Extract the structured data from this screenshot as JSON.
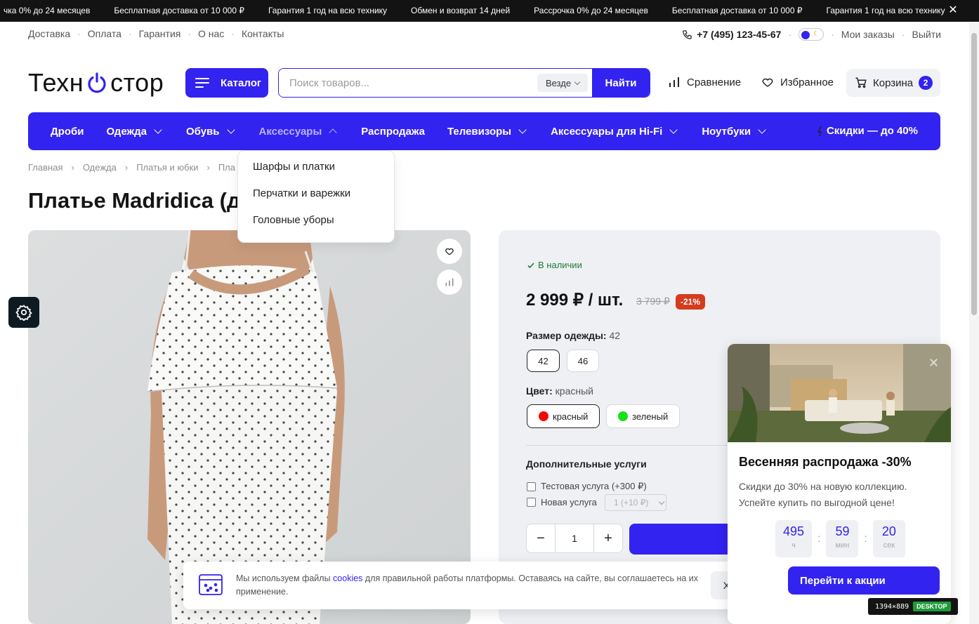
{
  "ticker": {
    "items": [
      "чка 0% до 24 месяцев",
      "Бесплатная доставка от 10 000 ₽",
      "Гарантия 1 год на всю технику",
      "Обмен и возврат 14 дней",
      "Рассрочка 0% до 24 месяцев",
      "Бесплатная доставка от 10 000 ₽",
      "Гарантия 1 год на всю технику"
    ],
    "close": "✕"
  },
  "util": {
    "links": [
      "Доставка",
      "Оплата",
      "Гарантия",
      "О нас",
      "Контакты"
    ],
    "phone": "+7 (495) 123-45-67",
    "orders": "Мои заказы",
    "logout": "Выйти"
  },
  "header": {
    "logo_left": "Техн",
    "logo_right": "стор",
    "catalog": "Каталог",
    "search_placeholder": "Поиск товаров...",
    "search_scope": "Везде",
    "search_button": "Найти",
    "compare": "Сравнение",
    "favorites": "Избранное",
    "cart": "Корзина",
    "cart_count": "2"
  },
  "nav": {
    "items": [
      "Дроби",
      "Одежда",
      "Обувь",
      "Аксессуары",
      "Распродажа",
      "Телевизоры",
      "Аксессуары для Hi-Fi",
      "Ноутбуки"
    ],
    "promo": "Скидки — до 40%"
  },
  "dropdown": {
    "items": [
      "Шарфы и платки",
      "Перчатки и варежки",
      "Головные уборы"
    ]
  },
  "breadcrumb": [
    "Главная",
    "Одежда",
    "Платья и юбки",
    "Пла"
  ],
  "product": {
    "title": "Платье Madridica (де",
    "stock": "В наличии",
    "price": "2 999 ₽ / шт.",
    "old_price": "3 799 ₽",
    "discount": "-21%",
    "size_label": "Размер одежды:",
    "size_value": "42",
    "sizes": [
      "42",
      "46"
    ],
    "color_label": "Цвет:",
    "color_value": "красный",
    "colors": [
      {
        "name": "красный",
        "hex": "#ff0000"
      },
      {
        "name": "зеленый",
        "hex": "#18e019"
      }
    ],
    "services_title": "Дополнительные услуги",
    "services": [
      "Тестовая услуга (+300 ₽)",
      "Новая услуга"
    ],
    "service_select": "1 (+10 ₽)",
    "qty": "1",
    "minus": "−",
    "plus": "+"
  },
  "promo_popup": {
    "close": "✕",
    "title": "Весенняя распродажа -30%",
    "text": "Скидки до 30% на новую коллекцию. Успейте купить по выгодной цене!",
    "timer": [
      {
        "value": "495",
        "unit": "ч"
      },
      {
        "value": "59",
        "unit": "мин"
      },
      {
        "value": "20",
        "unit": "сек"
      }
    ],
    "button": "Перейти к акции"
  },
  "cookie": {
    "text_before": "Мы используем файлы ",
    "link": "cookies",
    "text_after": " для правильной работы платформы. Оставаясь на сайте, вы соглашаетесь на их применение.",
    "button": "Хорошо"
  },
  "viewport_tag": {
    "size": "1394×889",
    "mode": "DESKTOP"
  },
  "colors": {
    "accent": "#3323f0",
    "ticker_bg": "#131313",
    "discount": "#d63b1e",
    "stock": "#1f7a3a"
  }
}
